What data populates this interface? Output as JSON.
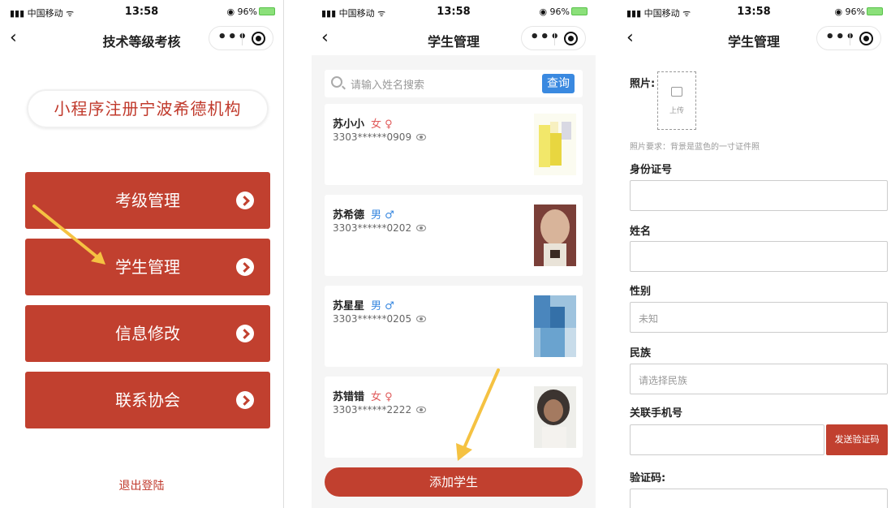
{
  "status": {
    "carrier": "中国移动",
    "time": "13:58",
    "battery": "96%"
  },
  "screen1": {
    "title": "技术等级考核",
    "brand": "小程序注册宁波希德机构",
    "menu": [
      {
        "label": "考级管理"
      },
      {
        "label": "学生管理"
      },
      {
        "label": "信息修改"
      },
      {
        "label": "联系协会"
      }
    ],
    "logout": "退出登陆"
  },
  "screen2": {
    "title": "学生管理",
    "search": {
      "placeholder": "请输入姓名搜索",
      "button": "查询"
    },
    "students": [
      {
        "name": "苏小小",
        "gender": "女",
        "id": "3303******0909"
      },
      {
        "name": "苏希德",
        "gender": "男",
        "id": "3303******0202"
      },
      {
        "name": "苏星星",
        "gender": "男",
        "id": "3303******0205"
      },
      {
        "name": "苏错错",
        "gender": "女",
        "id": "3303******2222"
      }
    ],
    "add_button": "添加学生"
  },
  "screen3": {
    "title": "学生管理",
    "photo_label": "照片:",
    "upload_text": "上传",
    "photo_hint": "照片要求：背景是蓝色的一寸证件照",
    "id_label": "身份证号",
    "name_label": "姓名",
    "gender_label": "性别",
    "gender_value": "未知",
    "ethnicity_label": "民族",
    "ethnicity_placeholder": "请选择民族",
    "phone_label": "关联手机号",
    "send_code": "发送验证码",
    "code_label": "验证码:"
  },
  "colors": {
    "primary": "#c1402f",
    "accent_blue": "#3a89e0",
    "annotation_arrow": "#f5c242"
  }
}
